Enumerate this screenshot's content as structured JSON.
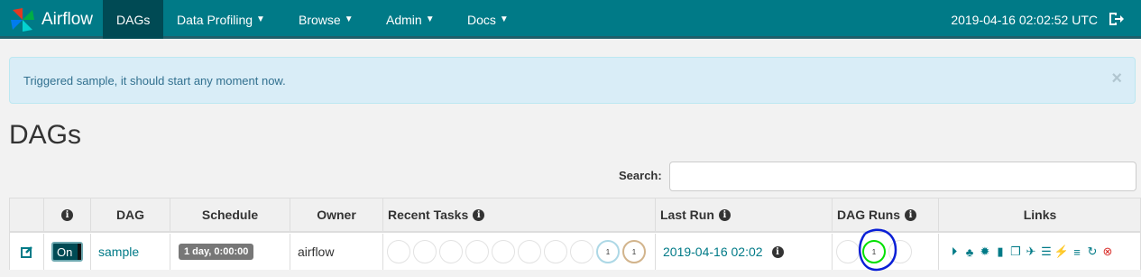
{
  "nav": {
    "brand": "Airflow",
    "items": [
      {
        "label": "DAGs",
        "dropdown": false,
        "active": true
      },
      {
        "label": "Data Profiling",
        "dropdown": true
      },
      {
        "label": "Browse",
        "dropdown": true
      },
      {
        "label": "Admin",
        "dropdown": true
      },
      {
        "label": "Docs",
        "dropdown": true
      }
    ],
    "time": "2019-04-16 02:02:52 UTC"
  },
  "alert": {
    "message": "Triggered sample, it should start any moment now.",
    "close": "×"
  },
  "page_title": "DAGs",
  "search": {
    "label": "Search:",
    "value": ""
  },
  "table": {
    "headers": {
      "info": "i",
      "dag": "DAG",
      "schedule": "Schedule",
      "owner": "Owner",
      "recent_tasks": "Recent Tasks",
      "last_run": "Last Run",
      "dag_runs": "DAG Runs",
      "links": "Links"
    },
    "row": {
      "toggle": "On",
      "dag": "sample",
      "schedule": "1 day, 0:00:00",
      "owner": "airflow",
      "recent_task_counts": [
        "",
        "",
        "",
        "",
        "",
        "",
        "",
        "",
        "1",
        "1"
      ],
      "last_run": "2019-04-16 02:02",
      "dag_run_counts": [
        "",
        "1",
        ""
      ]
    }
  },
  "colors": {
    "navbar": "#007A87",
    "nav_active": "#004a54",
    "alert_bg": "#d9edf7",
    "link": "#007A87"
  }
}
